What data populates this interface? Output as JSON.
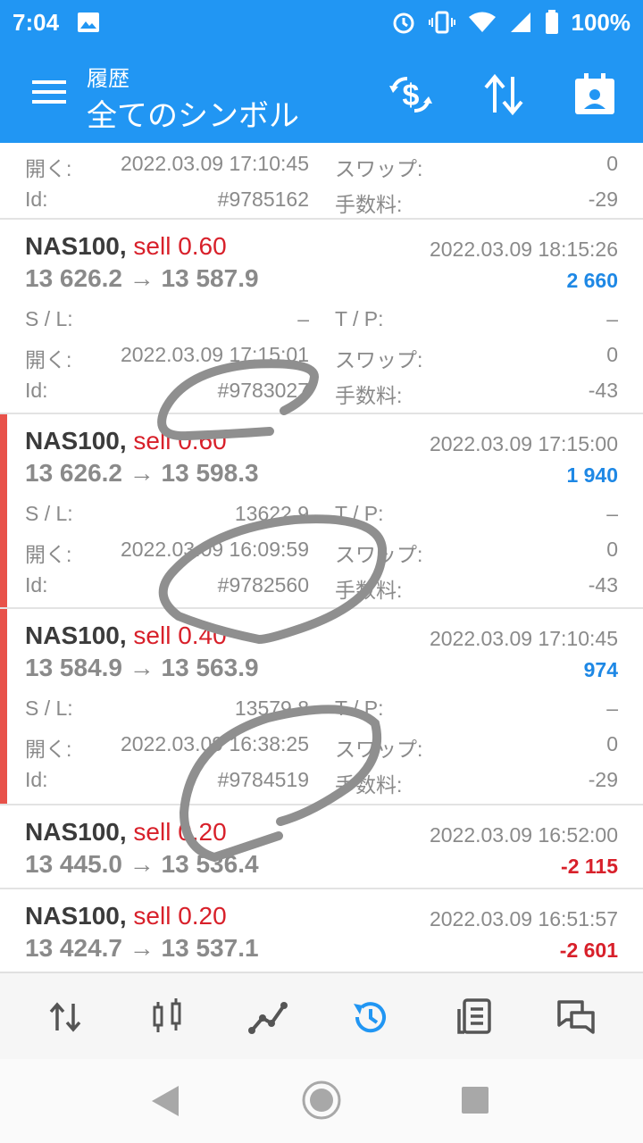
{
  "status": {
    "time": "7:04",
    "battery": "100%"
  },
  "header": {
    "subtitle": "履歴",
    "title": "全てのシンボル"
  },
  "labels": {
    "sl": "S / L:",
    "tp": "T / P:",
    "open": "開く:",
    "swap": "スワップ:",
    "id": "Id:",
    "fee": "手数料:"
  },
  "partial": {
    "open_time": "2022.03.09 17:10:45",
    "swap": "0",
    "id": "#9785162",
    "fee": "-29"
  },
  "trades": [
    {
      "symbol": "NAS100,",
      "side": "sell 0.60",
      "date": "2022.03.09 18:15:26",
      "prices": "13 626.2 → 13 587.9",
      "profit": "2 660",
      "profit_sign": "pos",
      "sl": "–",
      "tp": "–",
      "open_time": "2022.03.09 17:15:01",
      "swap": "0",
      "id": "#9783027",
      "fee": "-43"
    },
    {
      "symbol": "NAS100,",
      "side": "sell 0.60",
      "date": "2022.03.09 17:15:00",
      "prices": "13 626.2 → 13 598.3",
      "profit": "1 940",
      "profit_sign": "pos",
      "sl": "13622.9",
      "tp": "–",
      "open_time": "2022.03.09 16:09:59",
      "swap": "0",
      "id": "#9782560",
      "fee": "-43"
    },
    {
      "symbol": "NAS100,",
      "side": "sell 0.40",
      "date": "2022.03.09 17:10:45",
      "prices": "13 584.9 → 13 563.9",
      "profit": "974",
      "profit_sign": "pos",
      "sl": "13579.8",
      "tp": "–",
      "open_time": "2022.03.09 16:38:25",
      "swap": "0",
      "id": "#9784519",
      "fee": "-29"
    },
    {
      "symbol": "NAS100,",
      "side": "sell 0.20",
      "date": "2022.03.09 16:52:00",
      "prices": "13 445.0 → 13 536.4",
      "profit": "-2 115",
      "profit_sign": "neg"
    },
    {
      "symbol": "NAS100,",
      "side": "sell 0.20",
      "date": "2022.03.09 16:51:57",
      "prices": "13 424.7 → 13 537.1",
      "profit": "-2 601",
      "profit_sign": "neg"
    }
  ],
  "colors": {
    "brand": "#2196f3",
    "profit_positive": "#1e88e5",
    "profit_negative": "#d8202a",
    "marker": "#e8524a",
    "active_tab": "#2196f3"
  },
  "bottom_nav": [
    {
      "icon": "quotes-icon"
    },
    {
      "icon": "chart-icon"
    },
    {
      "icon": "trade-icon"
    },
    {
      "icon": "history-icon",
      "active": true
    },
    {
      "icon": "news-icon"
    },
    {
      "icon": "chat-icon"
    }
  ]
}
